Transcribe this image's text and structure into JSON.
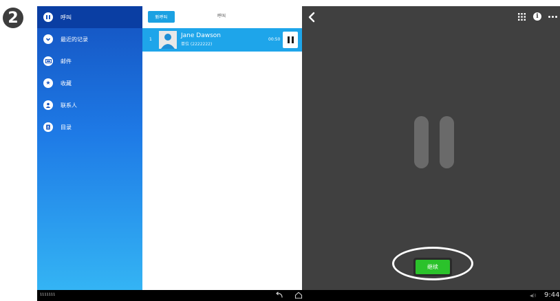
{
  "step_number": "2",
  "sidebar": {
    "items": [
      {
        "label": "呼叫",
        "icon": "pause-icon",
        "active": true
      },
      {
        "label": "最近的记录",
        "icon": "recents-icon",
        "active": false
      },
      {
        "label": "邮件",
        "icon": "voicemail-icon",
        "active": false
      },
      {
        "label": "收藏",
        "icon": "star-icon",
        "active": false
      },
      {
        "label": "联系人",
        "icon": "person-icon",
        "active": false
      },
      {
        "label": "目录",
        "icon": "directory-icon",
        "active": false
      }
    ]
  },
  "call_panel": {
    "new_call_label": "新呼叫",
    "title": "呼叫",
    "calls": [
      {
        "index": "1",
        "name": "Jane Dawson",
        "number": "单位 (2222222)",
        "duration": "00:50"
      }
    ]
  },
  "main": {
    "resume_label": "继续"
  },
  "system_bar": {
    "device_id": "1111111",
    "volume_glyph": "◀))",
    "time": "9:44"
  },
  "colors": {
    "sidebar_active": "#0a3ea3",
    "call_row": "#1ea5ea",
    "resume_green": "#2bc22b",
    "main_bg": "#404040"
  }
}
